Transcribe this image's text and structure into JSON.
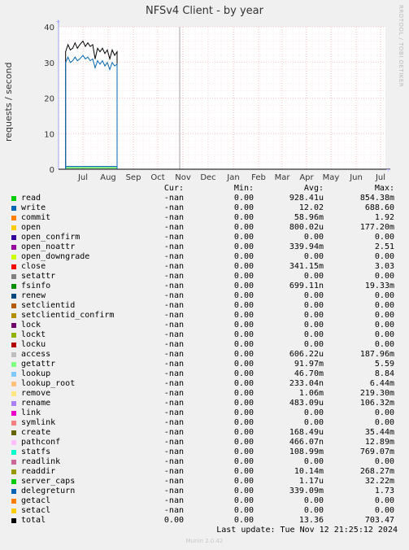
{
  "title": "NFSv4 Client - by year",
  "side_credit": "RRDTOOL / TOBI OETIKER",
  "ylabel": "requests / second",
  "legend_headers": {
    "cur": "Cur:",
    "min": "Min:",
    "avg": "Avg:",
    "max": "Max:"
  },
  "rows": [
    {
      "name": "read",
      "color": "#00cc00",
      "cur": "-nan",
      "min": "0.00",
      "avg": "928.41u",
      "max": "854.38m"
    },
    {
      "name": "write",
      "color": "#0066b3",
      "cur": "-nan",
      "min": "0.00",
      "avg": "12.02",
      "max": "688.60"
    },
    {
      "name": "commit",
      "color": "#ff8000",
      "cur": "-nan",
      "min": "0.00",
      "avg": "58.96m",
      "max": "1.92"
    },
    {
      "name": "open",
      "color": "#ffcc00",
      "cur": "-nan",
      "min": "0.00",
      "avg": "800.02u",
      "max": "177.20m"
    },
    {
      "name": "open_confirm",
      "color": "#330099",
      "cur": "-nan",
      "min": "0.00",
      "avg": "0.00",
      "max": "0.00"
    },
    {
      "name": "open_noattr",
      "color": "#990099",
      "cur": "-nan",
      "min": "0.00",
      "avg": "339.94m",
      "max": "2.51"
    },
    {
      "name": "open_downgrade",
      "color": "#ccff00",
      "cur": "-nan",
      "min": "0.00",
      "avg": "0.00",
      "max": "0.00"
    },
    {
      "name": "close",
      "color": "#ff0000",
      "cur": "-nan",
      "min": "0.00",
      "avg": "341.15m",
      "max": "3.03"
    },
    {
      "name": "setattr",
      "color": "#808080",
      "cur": "-nan",
      "min": "0.00",
      "avg": "0.00",
      "max": "0.00"
    },
    {
      "name": "fsinfo",
      "color": "#008f00",
      "cur": "-nan",
      "min": "0.00",
      "avg": "699.11n",
      "max": "19.33m"
    },
    {
      "name": "renew",
      "color": "#00487d",
      "cur": "-nan",
      "min": "0.00",
      "avg": "0.00",
      "max": "0.00"
    },
    {
      "name": "setclientid",
      "color": "#b35a00",
      "cur": "-nan",
      "min": "0.00",
      "avg": "0.00",
      "max": "0.00"
    },
    {
      "name": "setclientid_confirm",
      "color": "#b38f00",
      "cur": "-nan",
      "min": "0.00",
      "avg": "0.00",
      "max": "0.00"
    },
    {
      "name": "lock",
      "color": "#6b006b",
      "cur": "-nan",
      "min": "0.00",
      "avg": "0.00",
      "max": "0.00"
    },
    {
      "name": "lockt",
      "color": "#8fb300",
      "cur": "-nan",
      "min": "0.00",
      "avg": "0.00",
      "max": "0.00"
    },
    {
      "name": "locku",
      "color": "#b30000",
      "cur": "-nan",
      "min": "0.00",
      "avg": "0.00",
      "max": "0.00"
    },
    {
      "name": "access",
      "color": "#bebebe",
      "cur": "-nan",
      "min": "0.00",
      "avg": "606.22u",
      "max": "187.96m"
    },
    {
      "name": "getattr",
      "color": "#80ff80",
      "cur": "-nan",
      "min": "0.00",
      "avg": "91.97m",
      "max": "5.59"
    },
    {
      "name": "lookup",
      "color": "#80c9ff",
      "cur": "-nan",
      "min": "0.00",
      "avg": "46.70m",
      "max": "8.84"
    },
    {
      "name": "lookup_root",
      "color": "#ffc080",
      "cur": "-nan",
      "min": "0.00",
      "avg": "233.04n",
      "max": "6.44m"
    },
    {
      "name": "remove",
      "color": "#ffe680",
      "cur": "-nan",
      "min": "0.00",
      "avg": "1.06m",
      "max": "219.30m"
    },
    {
      "name": "rename",
      "color": "#aa80ff",
      "cur": "-nan",
      "min": "0.00",
      "avg": "483.09u",
      "max": "106.32m"
    },
    {
      "name": "link",
      "color": "#ee00cc",
      "cur": "-nan",
      "min": "0.00",
      "avg": "0.00",
      "max": "0.00"
    },
    {
      "name": "symlink",
      "color": "#ff8080",
      "cur": "-nan",
      "min": "0.00",
      "avg": "0.00",
      "max": "0.00"
    },
    {
      "name": "create",
      "color": "#666600",
      "cur": "-nan",
      "min": "0.00",
      "avg": "168.49u",
      "max": "35.44m"
    },
    {
      "name": "pathconf",
      "color": "#ffbfff",
      "cur": "-nan",
      "min": "0.00",
      "avg": "466.07n",
      "max": "12.89m"
    },
    {
      "name": "statfs",
      "color": "#00ffcc",
      "cur": "-nan",
      "min": "0.00",
      "avg": "108.99m",
      "max": "769.07m"
    },
    {
      "name": "readlink",
      "color": "#cc6699",
      "cur": "-nan",
      "min": "0.00",
      "avg": "0.00",
      "max": "0.00"
    },
    {
      "name": "readdir",
      "color": "#999900",
      "cur": "-nan",
      "min": "0.00",
      "avg": "10.14m",
      "max": "268.27m"
    },
    {
      "name": "server_caps",
      "color": "#00cc00",
      "cur": "-nan",
      "min": "0.00",
      "avg": "1.17u",
      "max": "32.22m"
    },
    {
      "name": "delegreturn",
      "color": "#0066b3",
      "cur": "-nan",
      "min": "0.00",
      "avg": "339.09m",
      "max": "1.73"
    },
    {
      "name": "getacl",
      "color": "#ff8000",
      "cur": "-nan",
      "min": "0.00",
      "avg": "0.00",
      "max": "0.00"
    },
    {
      "name": "setacl",
      "color": "#ffcc00",
      "cur": "-nan",
      "min": "0.00",
      "avg": "0.00",
      "max": "0.00"
    },
    {
      "name": "total",
      "color": "#000000",
      "cur": "0.00",
      "min": "0.00",
      "avg": "13.36",
      "max": "703.47"
    }
  ],
  "last_update": "Last update: Tue Nov 12 21:25:12 2024",
  "footer": "Munin 2.0.42",
  "chart_data": {
    "type": "line",
    "title": "NFSv4 Client - by year",
    "ylabel": "requests / second",
    "xlabel": "",
    "ylim": [
      0,
      40
    ],
    "yticks": [
      0,
      10,
      20,
      30,
      40
    ],
    "x_tick_labels": [
      "Jul",
      "Aug",
      "Sep",
      "Oct",
      "Nov",
      "Dec",
      "Jan",
      "Feb",
      "Mar",
      "Apr",
      "May",
      "Jun",
      "Jul"
    ],
    "grid": true,
    "series": [
      {
        "name": "total",
        "color": "#000000",
        "x": [
          "Jun 10",
          "Jun 13",
          "Jun 16",
          "Jun 19",
          "Jun 22",
          "Jun 25",
          "Jun 28",
          "Jul 1",
          "Jul 4",
          "Jul 7",
          "Jul 10",
          "Jul 13",
          "Jul 16",
          "Jul 19",
          "Jul 22",
          "Jul 25",
          "Jul 28",
          "Jul 31",
          "Aug 3",
          "Aug 6",
          "Aug 9",
          "Aug 12"
        ],
        "values": [
          33,
          35,
          33.5,
          34,
          35.5,
          34,
          35,
          36,
          34.5,
          35.5,
          34.5,
          35,
          31,
          34,
          33,
          34,
          32.5,
          33.5,
          31,
          33.5,
          32,
          33
        ]
      },
      {
        "name": "write",
        "color": "#0066b3",
        "x": [
          "Jun 10",
          "Jun 13",
          "Jun 16",
          "Jun 19",
          "Jun 22",
          "Jun 25",
          "Jun 28",
          "Jul 1",
          "Jul 4",
          "Jul 7",
          "Jul 10",
          "Jul 13",
          "Jul 16",
          "Jul 19",
          "Jul 22",
          "Jul 25",
          "Jul 28",
          "Jul 31",
          "Aug 3",
          "Aug 6",
          "Aug 9",
          "Aug 12"
        ],
        "values": [
          30,
          31.5,
          30,
          30.5,
          31.5,
          30.5,
          31,
          32,
          31,
          31.5,
          30.5,
          31,
          28.5,
          30.5,
          29.5,
          30.5,
          29,
          30,
          28,
          30,
          29,
          29.5
        ]
      },
      {
        "name": "read",
        "color": "#00cc00",
        "x": [
          "Jun 10",
          "Aug 12"
        ],
        "values": [
          0.4,
          0.4
        ]
      },
      {
        "name": "delegreturn",
        "color": "#0066b3",
        "x": [
          "Jun 10",
          "Aug 12"
        ],
        "values": [
          0.8,
          0.8
        ]
      }
    ]
  }
}
